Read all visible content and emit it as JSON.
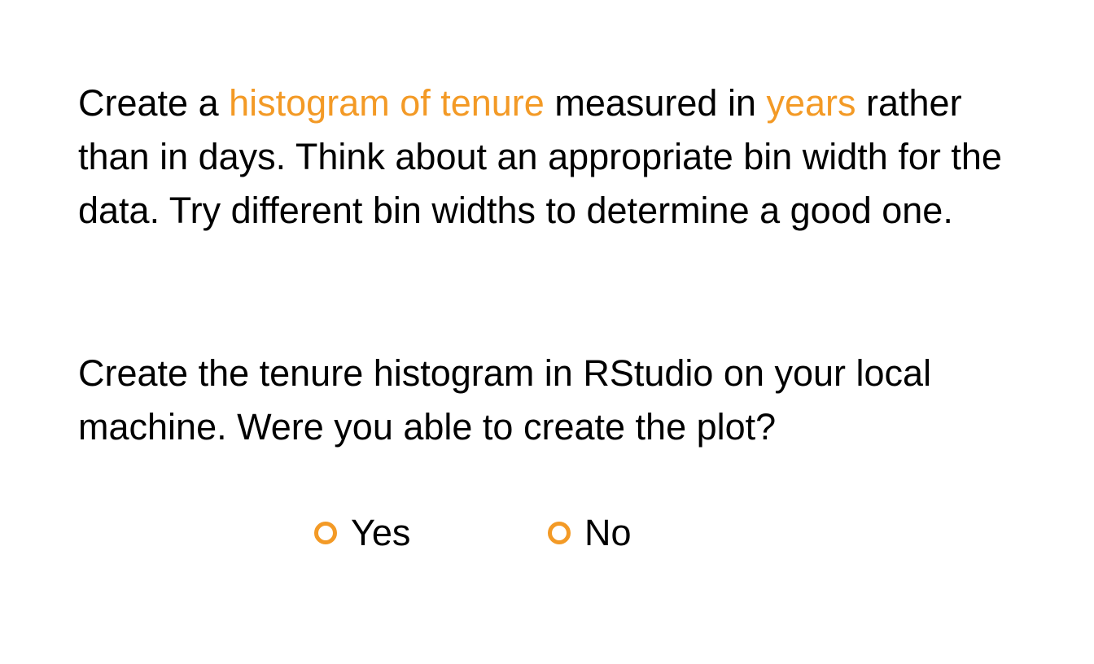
{
  "prompt": {
    "part1": "Create a ",
    "highlight1": "histogram of tenure",
    "part2": " measured in ",
    "highlight2": "years",
    "part3": " rather than in days. Think about an appropriate bin width for the data. Try different bin widths to determine a good one."
  },
  "question": {
    "text": "Create the tenure histogram in RStudio on your local machine. Were you able to create the plot?"
  },
  "choices": [
    {
      "label": "Yes",
      "selected": false
    },
    {
      "label": "No",
      "selected": false
    }
  ],
  "colors": {
    "accent": "#f39a26",
    "text": "#000000",
    "background": "#ffffff"
  }
}
